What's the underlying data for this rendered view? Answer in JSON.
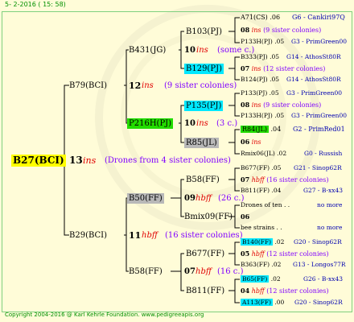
{
  "header": {
    "date_text": "5-  2-2016 ( 15: 58)"
  },
  "footer": {
    "copyright": "Copyright 2004-2016 @ Karl Kehrle Foundation.   www.pedigreeapis.org"
  },
  "root": {
    "name": "B27(BCI)",
    "num": "13",
    "ins": "ins",
    "note": "(Drones from 4 sister colonies)"
  },
  "gen1": {
    "father": {
      "name": "B79(BCI)",
      "num": "12",
      "ins": "ins",
      "note": "(9 sister colonies)"
    },
    "mother": {
      "name": "B29(BCI)",
      "num": "11",
      "ins": "hbff",
      "note": "(16 sister colonies)"
    }
  },
  "gen2": {
    "f_father": {
      "name": "B431(JG)"
    },
    "f_mother": {
      "name": "P216H(PJ)",
      "num": "10",
      "ins": "ins",
      "note": "(3 c.)"
    },
    "m_father": {
      "name": "B50(FF)",
      "num": "09",
      "ins": "hbff",
      "note": "(26 c.)"
    },
    "m_mother": {
      "name": "B58(FF)"
    }
  },
  "gen3": [
    {
      "name": "B103(PJ)",
      "num": "10",
      "ins": "ins",
      "note": "(some c.)"
    },
    {
      "name": "B129(PJ)"
    },
    {
      "name": "P135(PJ)"
    },
    {
      "name": "R85(JL)"
    },
    {
      "name": "B58(FF)"
    },
    {
      "name": "Bmix09(FF)"
    },
    {
      "name": "B677(FF)",
      "num": "07",
      "ins": "hbff",
      "note": "(16 c.)"
    },
    {
      "name": "B811(FF)"
    }
  ],
  "gen4": [
    {
      "name": "A71(CS)",
      "num": ".06",
      "extra": "G6 - Cankiri97Q"
    },
    {
      "num": "08",
      "ins": "ins",
      "note": "(9 sister colonies)"
    },
    {
      "name": "P133H(PJ)",
      "num": ".05",
      "extra": "G3 - PrimGreen00"
    },
    {
      "name": "B333(PJ)",
      "num": ".05",
      "extra": "G14 - AthosSt80R"
    },
    {
      "num": "07",
      "ins": "ins",
      "note": "(12 sister colonies)"
    },
    {
      "name": "B124(PJ)",
      "num": ".05",
      "extra": "G14 - AthosSt80R"
    },
    {
      "name": "P133(PJ)",
      "num": ".05",
      "extra": "G3 - PrimGreen00"
    },
    {
      "num": "08",
      "ins": "ins",
      "note": "(9 sister colonies)"
    },
    {
      "name": "P133H(PJ)",
      "num": ".05",
      "extra": "G3 - PrimGreen00"
    },
    {
      "name": "R84(JL)",
      "num": ".04",
      "extra": "G2 - PrimRed01"
    },
    {
      "num": "06",
      "ins": "ins"
    },
    {
      "name": "Rmix06(JL)",
      "num": ".02",
      "extra": "G0 - Russish"
    },
    {
      "name": "B677(FF)",
      "num": ".05",
      "extra": "G21 - Sinop62R"
    },
    {
      "num": "07",
      "ins": "hbff",
      "note": "(16 sister colonies)"
    },
    {
      "name": "B811(FF)",
      "num": ".04",
      "extra": "G27 - B-xx43"
    },
    {
      "name": "Drones of ten . .",
      "extra": "no more"
    },
    {
      "num": "06"
    },
    {
      "name": "bee strains . .",
      "extra": "no more"
    },
    {
      "name": "B140(FF)",
      "num": ".02",
      "extra": "G20 - Sinop62R"
    },
    {
      "num": "05",
      "ins": "hbff",
      "note": "(12 sister colonies)"
    },
    {
      "name": "B363(FF)",
      "num": ".02",
      "extra": "G13 - Longos77R"
    },
    {
      "name": "B65(FF)",
      "num": ".02",
      "extra": "G26 - B-xx43"
    },
    {
      "num": "04",
      "ins": "hbff",
      "note": "(12 sister colonies)"
    },
    {
      "name": "A113(FF)",
      "num": ".00",
      "extra": "G20 - Sinop62R"
    }
  ]
}
